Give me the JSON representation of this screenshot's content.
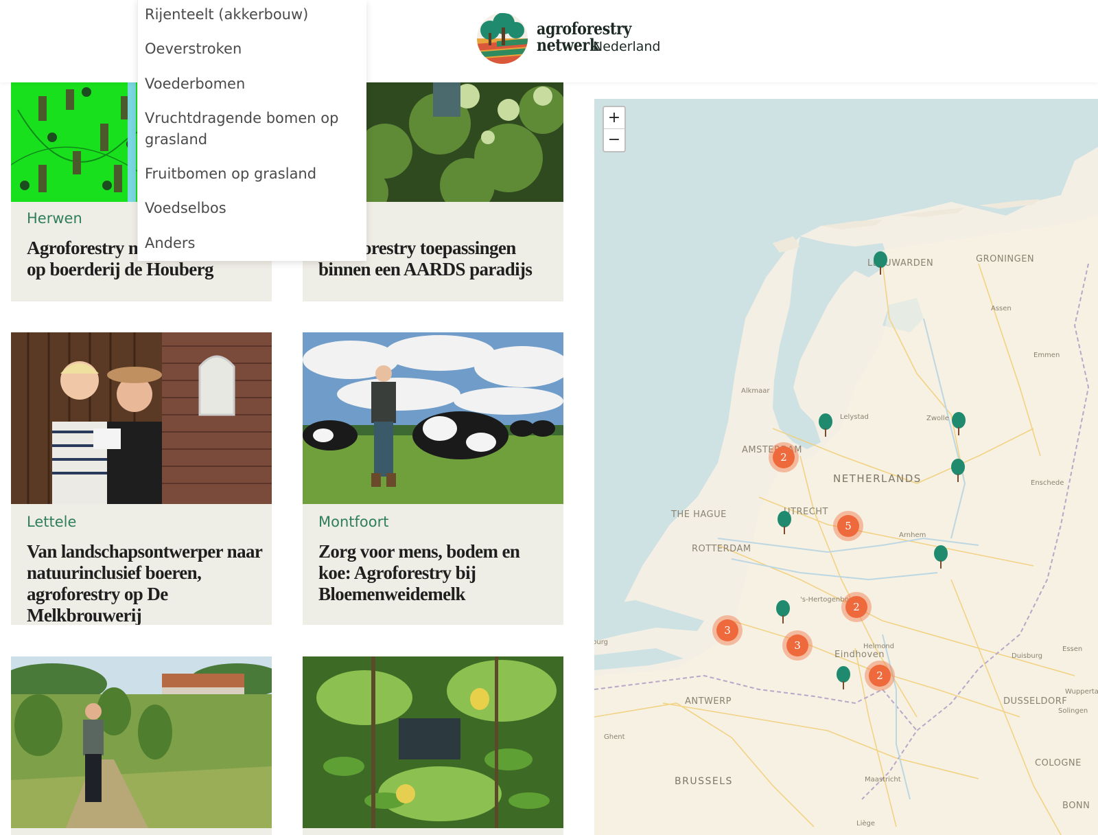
{
  "header": {
    "logo_line1": "agroforestry",
    "logo_line2": "netwerk",
    "logo_line3": "Nederland",
    "colors": {
      "green": "#1f8a6e",
      "orange": "#e9a33b",
      "red": "#d9583b",
      "dark": "#1d2a24"
    }
  },
  "dropdown": {
    "items": [
      "Rijenteelt (akkerbouw)",
      "Oeverstroken",
      "Voederbomen",
      "Vruchtdragende bomen op grasland",
      "Fruitbomen op grasland",
      "Voedselbos",
      "Anders"
    ]
  },
  "cards": [
    {
      "location": "Herwen",
      "title": "Agroforestry met een plukbos op boerderij de Houberg"
    },
    {
      "location": "",
      "title": "Agroforestry toepassingen binnen een AARDS paradijs"
    },
    {
      "location": "Lettele",
      "title": "Van landschapsontwerper naar natuurinclusief boeren, agroforestry op De Melkbrouwerij"
    },
    {
      "location": "Montfoort",
      "title": "Zorg voor mens, bodem en koe: Agroforestry bij Bloemenweidemelk"
    },
    {
      "location": "",
      "title": ""
    },
    {
      "location": "",
      "title": ""
    }
  ],
  "map": {
    "zoom_in": "+",
    "zoom_out": "−",
    "labels": {
      "leeuwarden": "LEEUWARDEN",
      "groningen": "GRONINGEN",
      "assen": "Assen",
      "emmen": "Emmen",
      "alkmaar": "Alkmaar",
      "lelystad": "Lelystad",
      "zwolle": "Zwolle",
      "amsterdam": "AMSTERDAM",
      "netherlands": "NETHERLANDS",
      "enschede": "Enschede",
      "the_hague": "THE HAGUE",
      "utrecht": "UTRECHT",
      "rotterdam": "ROTTERDAM",
      "arnhem": "Arnhem",
      "hertogenbosch": "'s-Hertogenbosch",
      "middelburg": "Middelburg",
      "helmond": "Helmond",
      "eindhoven": "Eindhoven",
      "duisburg": "Duisburg",
      "essen": "Essen",
      "antwerp": "ANTWERP",
      "dusseldorf": "DUSSELDORF",
      "wuppertal": "Wuppertal",
      "solingen": "Solingen",
      "ghent": "Ghent",
      "cologne": "COLOGNE",
      "brussels": "BRUSSELS",
      "maastricht": "Maastricht",
      "bonn": "BONN",
      "liege": "Liège"
    },
    "clusters": [
      {
        "id": "amsterdam",
        "count": "2"
      },
      {
        "id": "utrecht-east",
        "count": "5"
      },
      {
        "id": "den-bosch",
        "count": "2"
      },
      {
        "id": "breda",
        "count": "3"
      },
      {
        "id": "tilburg",
        "count": "3"
      },
      {
        "id": "helmond",
        "count": "2"
      }
    ],
    "marker_color": "#1f8a6e",
    "cluster_color": "#ee6a3c"
  }
}
